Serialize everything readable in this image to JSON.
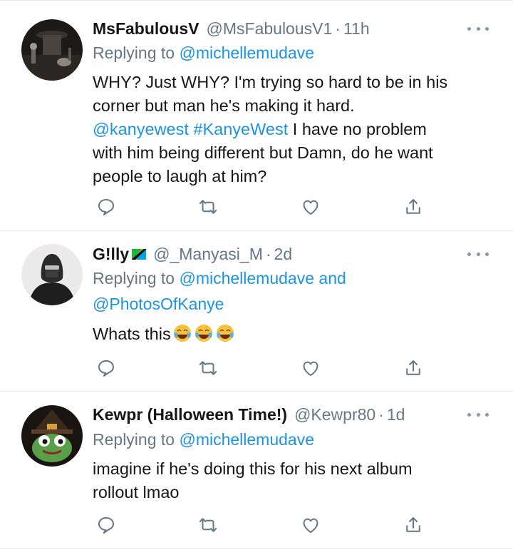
{
  "tweets": [
    {
      "name": "MsFabulousV",
      "handle": "@MsFabulousV1",
      "dot": "·",
      "time": "11h",
      "replying_prefix": "Replying to",
      "replying_to": [
        "@michellemudave"
      ],
      "body_lines": [
        "WHY? Just WHY? I'm trying so hard to be in his",
        "corner but man he's making it hard."
      ],
      "body_mention": "@kanyewest",
      "body_hashtag": "#KanyeWest",
      "body_line3_rest": " I have no problem",
      "body_line4": "with him being different but Damn, do he want",
      "body_line5": "people to laugh at him?",
      "avatar_icon": "avatar-dark-room-icon"
    },
    {
      "name": "G!lly",
      "flag_icon": "tanzania-flag-icon",
      "handle": "@_Manyasi_M",
      "dot": "·",
      "time": "2d",
      "replying_prefix": "Replying to",
      "replying_to_1": "@michellemudave",
      "replying_and": "and",
      "replying_to_2": "@PhotosOfKanye",
      "body_text": "Whats this",
      "body_emojis": [
        "face-with-tears-of-joy-icon",
        "face-with-tears-of-joy-icon",
        "face-with-tears-of-joy-icon"
      ],
      "avatar_icon": "avatar-hooded-figure-icon"
    },
    {
      "name": "Kewpr (Halloween Time!)",
      "handle": "@Kewpr80",
      "dot": "·",
      "time": "1d",
      "replying_prefix": "Replying to",
      "replying_to_1": "@michellemudave",
      "body_lines": [
        "imagine if he's doing this for his next album",
        "rollout lmao"
      ],
      "avatar_icon": "avatar-frog-witch-icon"
    }
  ],
  "colors": {
    "text": "#14171a",
    "secondary": "#657786",
    "link": "#1b95e0",
    "divider": "#e6ecf0",
    "icon": "#657786"
  },
  "action_icons": [
    "reply-icon",
    "retweet-icon",
    "like-icon",
    "share-icon"
  ]
}
